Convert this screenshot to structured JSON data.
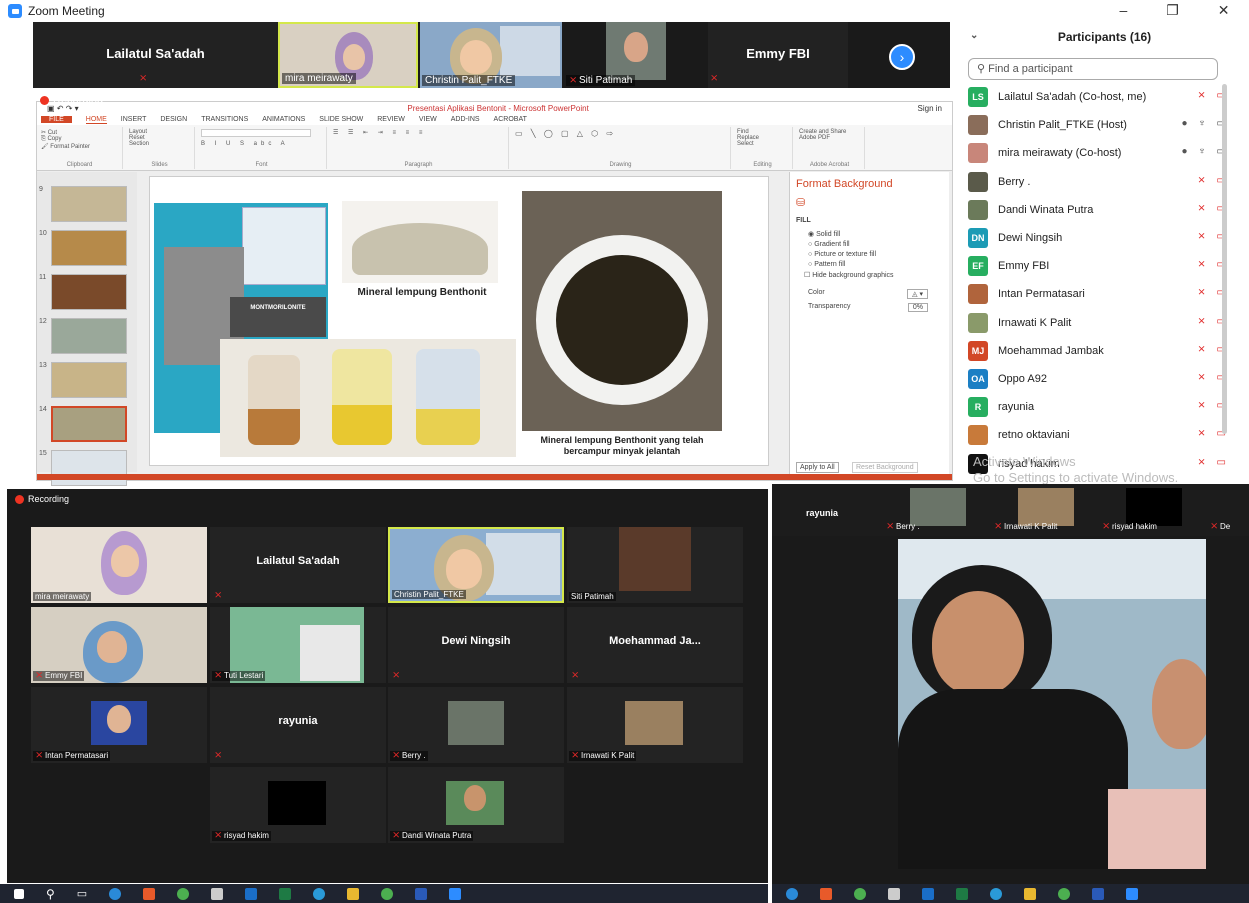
{
  "window": {
    "title": "Zoom Meeting",
    "min": "–",
    "max": "❐",
    "close": "✕"
  },
  "strip": {
    "tiles": [
      {
        "name": "Lailatul Sa'adah",
        "kind": "name"
      },
      {
        "label": "mira meirawaty",
        "kind": "video"
      },
      {
        "label": "Christin Palit_FTKE",
        "kind": "video"
      },
      {
        "label": "Siti Patimah",
        "kind": "video"
      },
      {
        "name": "Emmy FBI",
        "kind": "name"
      }
    ],
    "next_icon": "chevron-right-icon"
  },
  "recording_label": "Recording",
  "ppt": {
    "title": "Presentasi Aplikasi Bentonit - Microsoft PowerPoint",
    "signin": "Sign in",
    "tabs": [
      "FILE",
      "HOME",
      "INSERT",
      "DESIGN",
      "TRANSITIONS",
      "ANIMATIONS",
      "SLIDE SHOW",
      "REVIEW",
      "VIEW",
      "ADD-INS",
      "ACROBAT"
    ],
    "groups": [
      "Clipboard",
      "Slides",
      "Font",
      "Paragraph",
      "Drawing",
      "Editing",
      "Adobe Acrobat"
    ],
    "clipboard": {
      "cut": "Cut",
      "copy": "Copy",
      "painter": "Format Painter",
      "paste": "Paste"
    },
    "slides_grp": {
      "new": "New Slide",
      "layout": "Layout",
      "reset": "Reset",
      "section": "Section"
    },
    "editing": {
      "find": "Find",
      "replace": "Replace",
      "select": "Select"
    },
    "acrobat": "Create and Share Adobe PDF",
    "thumb_numbers": [
      "9",
      "10",
      "11",
      "12",
      "13",
      "14",
      "15"
    ],
    "slide": {
      "label_mont": "MONTMORILONITE",
      "caption1": "Mineral lempung Benthonit",
      "caption2": "Mineral lempung Benthonit yang telah bercampur minyak jelantah"
    },
    "format": {
      "title": "Format Background",
      "fill": "FILL",
      "options": [
        "Solid fill",
        "Gradient fill",
        "Picture or texture fill",
        "Pattern fill"
      ],
      "hide": "Hide background graphics",
      "color": "Color",
      "transparency": "Transparency",
      "transparency_val": "0%",
      "apply": "Apply to All",
      "reset": "Reset Background"
    }
  },
  "participants": {
    "title": "Participants (16)",
    "search_placeholder": "Find a participant",
    "list": [
      {
        "name": "Lailatul Sa'adah (Co-host, me)",
        "initials": "LS",
        "color": "#27ae60",
        "muted": true
      },
      {
        "name": "Christin Palit_FTKE (Host)",
        "initials": "",
        "color": "#8a6d5a",
        "muted": false
      },
      {
        "name": "mira meirawaty (Co-host)",
        "initials": "",
        "color": "#c8867a",
        "muted": false
      },
      {
        "name": "Berry .",
        "initials": "",
        "color": "#5a5a4a",
        "muted": true
      },
      {
        "name": "Dandi Winata Putra",
        "initials": "",
        "color": "#6b7a5a",
        "muted": true
      },
      {
        "name": "Dewi Ningsih",
        "initials": "DN",
        "color": "#1c9bb5",
        "muted": true
      },
      {
        "name": "Emmy FBI",
        "initials": "EF",
        "color": "#27ae60",
        "muted": true
      },
      {
        "name": "Intan Permatasari",
        "initials": "",
        "color": "#b0643c",
        "muted": true
      },
      {
        "name": "Irnawati K Palit",
        "initials": "",
        "color": "#8a9a6a",
        "muted": true
      },
      {
        "name": "Moehammad Jambak",
        "initials": "MJ",
        "color": "#d24726",
        "muted": true
      },
      {
        "name": "Oppo A92",
        "initials": "OA",
        "color": "#1c7fc4",
        "muted": true
      },
      {
        "name": "rayunia",
        "initials": "R",
        "color": "#27ae60",
        "muted": true
      },
      {
        "name": "retno oktaviani",
        "initials": "",
        "color": "#c87a3a",
        "muted": true
      },
      {
        "name": "risyad hakim",
        "initials": "",
        "color": "#111111",
        "muted": true
      }
    ],
    "watermark_1": "Activate Windows",
    "watermark_2": "Go to Settings to activate Windows."
  },
  "gallery": {
    "tiles": [
      {
        "label": "mira meirawaty",
        "video": true
      },
      {
        "name": "Lailatul Sa'adah",
        "video": false
      },
      {
        "label": "Christin Palit_FTKE",
        "video": true
      },
      {
        "label": "Siti Patimah",
        "video": true
      },
      {
        "label": "Emmy FBI",
        "video": true
      },
      {
        "label": "Tuti Lestari",
        "video": true
      },
      {
        "name": "Dewi Ningsih",
        "video": false
      },
      {
        "name": "Moehammad  Ja...",
        "video": false
      },
      {
        "label": "Intan Permatasari",
        "video": true
      },
      {
        "name": "rayunia",
        "video": false
      },
      {
        "label": "Berry .",
        "video": true
      },
      {
        "label": "Irnawati K Palit",
        "video": true
      },
      {
        "label": "risyad hakim",
        "video": true
      },
      {
        "label": "Dandi Winata Putra",
        "video": true
      }
    ]
  },
  "right_strip": [
    "rayunia",
    "Berry .",
    "Irnawati K Palit",
    "risyad hakim",
    "De"
  ],
  "taskbar_icons": [
    "windows-icon",
    "search-icon",
    "taskview-icon",
    "edge-icon",
    "app-icon",
    "chrome-icon",
    "store-icon",
    "outlook-icon",
    "excel-icon",
    "ie-icon",
    "explorer-icon",
    "chrome2-icon",
    "word-icon",
    "zoom-icon"
  ]
}
